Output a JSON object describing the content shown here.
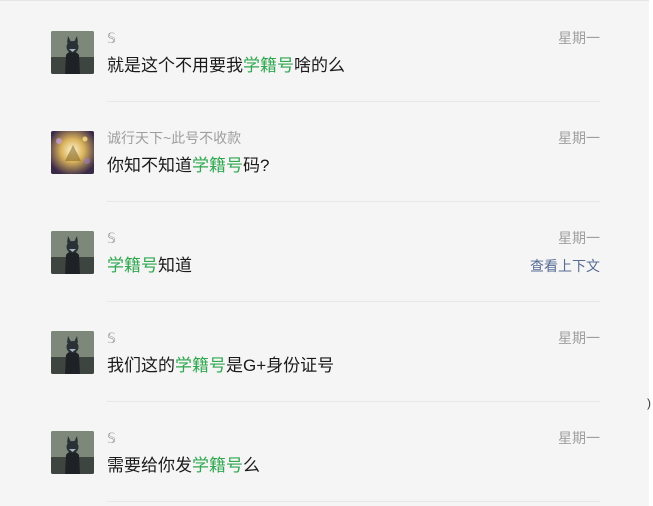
{
  "results": [
    {
      "sender": "𝕊",
      "date": "星期一",
      "message": {
        "before": "就是这个不用要我",
        "highlight": "学籍号",
        "after": "啥的么"
      },
      "avatar": "cat-dark-avatar"
    },
    {
      "sender": "诚行天下~此号不收款",
      "date": "星期一",
      "message": {
        "before": "你知不知道",
        "highlight": "学籍号",
        "after": "码?"
      },
      "avatar": "golden-light-avatar"
    },
    {
      "sender": "𝕊",
      "date": "星期一",
      "message": {
        "before": "",
        "highlight": "学籍号",
        "after": "知道"
      },
      "context_link": "查看上下文",
      "avatar": "cat-dark-avatar"
    },
    {
      "sender": "𝕊",
      "date": "星期一",
      "message": {
        "before": "我们这的",
        "highlight": "学籍号",
        "after": "是G+身份证号"
      },
      "avatar": "cat-dark-avatar"
    },
    {
      "sender": "𝕊",
      "date": "星期一",
      "message": {
        "before": "需要给你发",
        "highlight": "学籍号",
        "after": "么"
      },
      "avatar": "cat-dark-avatar"
    }
  ],
  "colors": {
    "highlight": "#2fa84f",
    "link": "#576b95",
    "meta": "#9e9e9e",
    "background": "#f5f5f5"
  },
  "edge_glyph": ")"
}
